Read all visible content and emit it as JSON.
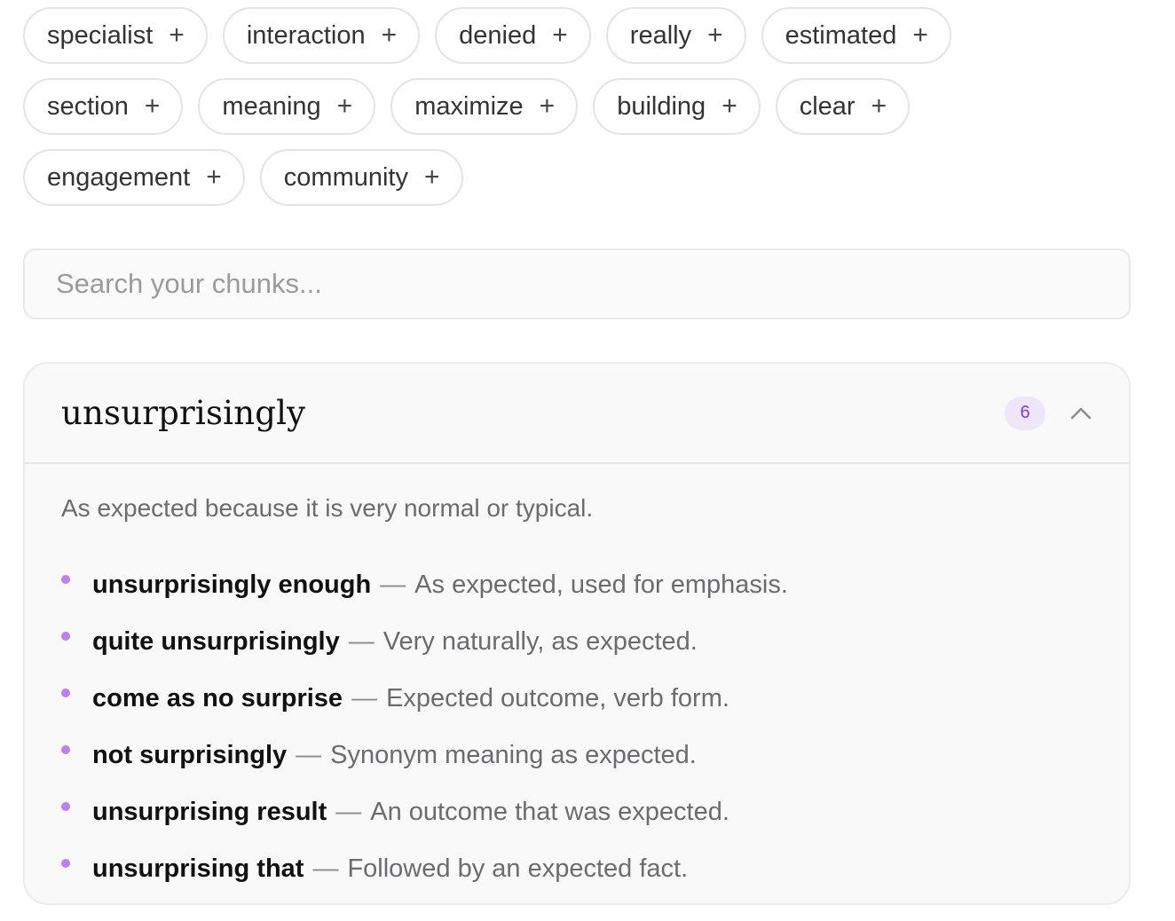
{
  "chips": {
    "row1": [
      "specialist",
      "interaction",
      "denied",
      "really",
      "estimated"
    ],
    "row2": [
      "section",
      "meaning",
      "maximize",
      "building",
      "clear"
    ],
    "row3": [
      "engagement",
      "community"
    ],
    "plus_symbol": "+"
  },
  "search": {
    "placeholder": "Search your chunks..."
  },
  "card": {
    "title": "unsurprisingly",
    "count": "6",
    "collapse_icon": "chevron-up-icon",
    "definition": "As expected because it is very normal or typical.",
    "separator": "—",
    "items": [
      {
        "phrase": "unsurprisingly enough",
        "meaning": "As expected, used for emphasis."
      },
      {
        "phrase": "quite unsurprisingly",
        "meaning": "Very naturally, as expected."
      },
      {
        "phrase": "come as no surprise",
        "meaning": "Expected outcome, verb form."
      },
      {
        "phrase": "not surprisingly",
        "meaning": "Synonym meaning as expected."
      },
      {
        "phrase": "unsurprising result",
        "meaning": "An outcome that was expected."
      },
      {
        "phrase": "unsurprising that",
        "meaning": "Followed by an expected fact."
      }
    ]
  },
  "colors": {
    "accent": "#7c3aed",
    "bullet": "#c07ef0",
    "badge_bg": "#efe6fa"
  }
}
